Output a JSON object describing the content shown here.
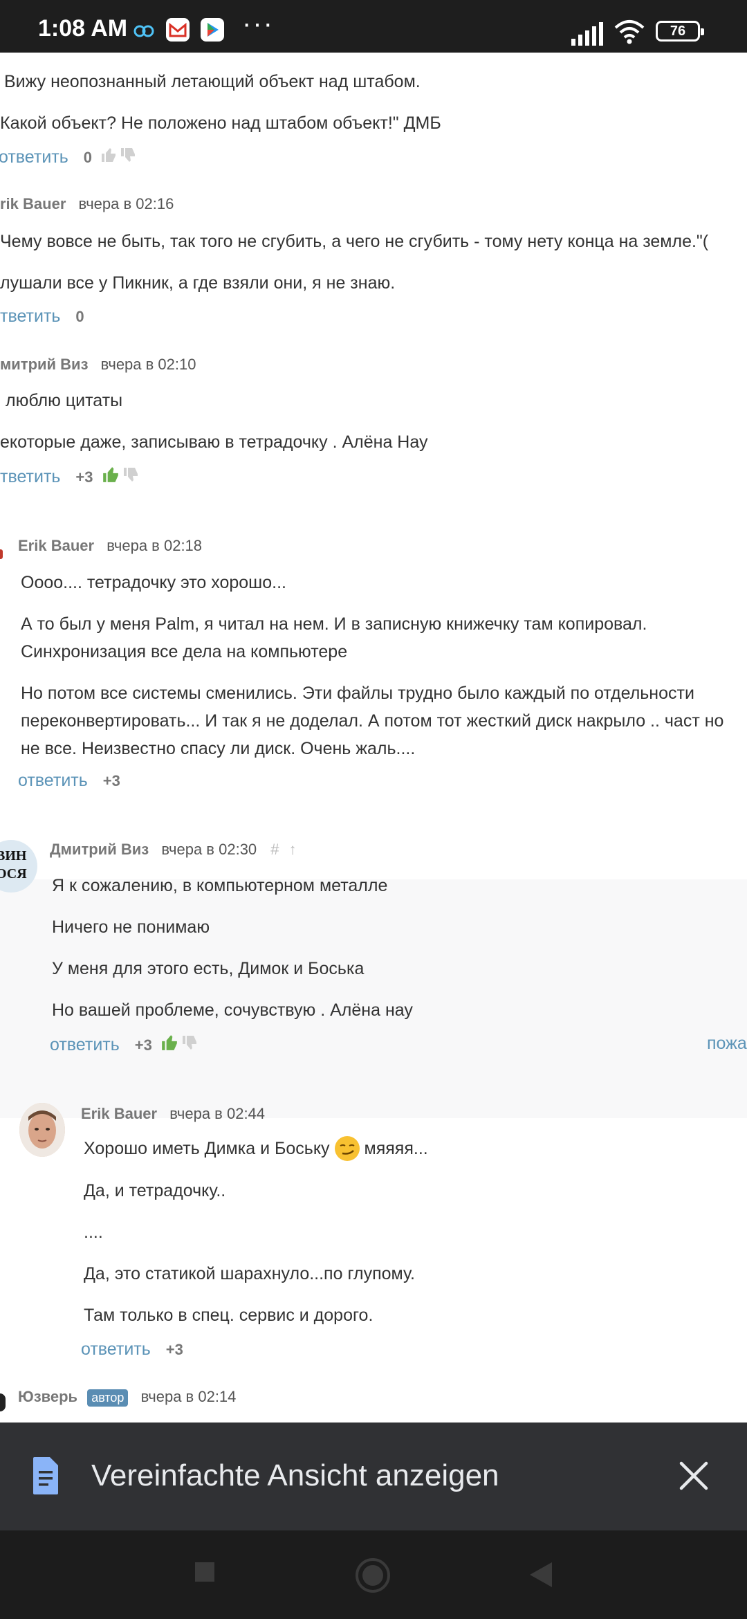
{
  "status_bar": {
    "time": "1:08 AM",
    "more_dots": "···",
    "battery": "76"
  },
  "comments": [
    {
      "paragraphs": [
        "Вижу неопознанный летающий объект над штабом.",
        "Какой объект? Не положено над штабом объект!\" ДМБ"
      ],
      "reply": "ответить",
      "score": "0"
    },
    {
      "author": "rik Bauer",
      "date": "вчера в 02:16",
      "paragraphs": [
        "Чему вовсе не быть, так того не сгубить, а чего не сгубить - тому нету конца на земле.\"(",
        "лушали все у Пикник, а где взяли они, я не знаю."
      ],
      "reply": "тветить",
      "score": "0"
    },
    {
      "author": "митрий Виз",
      "date": "вчера в 02:10",
      "paragraphs": [
        "люблю цитаты",
        "екоторые даже, записываю в тетрадочку . Алёна Нау"
      ],
      "reply": "тветить",
      "score": "+3"
    },
    {
      "author": "Erik Bauer",
      "date": "вчера в 02:18",
      "paragraphs": [
        "Оооо.... тетрадочку это хорошо...",
        "А то был у меня Palm, я читал на нем. И в записную книжечку там копировал. Синхронизация все дела на компьютере",
        "Но потом все системы сменились. Эти файлы трудно было каждый по отдельности переконвертировать... И так я не доделал. А потом тот жесткий диск накрыло .. част но не все. Неизвестно спасу ли диск. Очень жаль...."
      ],
      "reply": "ответить",
      "score": "+3"
    },
    {
      "author": "Дмитрий Виз",
      "date": "вчера в 02:30",
      "hash": "#",
      "up": "↑",
      "avatar_text_1": "ВИН",
      "avatar_text_2": "ОСЯ",
      "paragraphs": [
        "Я к сожалению, в компьютерном металле",
        "Ничего не понимаю",
        "У меня для этого есть, Димок и Боська",
        "Но вашей проблеме, сочувствую . Алёна нау"
      ],
      "reply": "ответить",
      "score": "+3",
      "complain": "пожа"
    },
    {
      "author": "Erik Bauer",
      "date": "вчера в 02:44",
      "paragraphs": [
        "Хорошо иметь Димка и Боську",
        "мяяяя...",
        "Да, и тетрадочку..",
        "....",
        "Да, это статикой шарахнуло...по глупому.",
        "Там только в спец. сервис и дорого."
      ],
      "reply": "ответить",
      "score": "+3"
    },
    {
      "author": "Юзверь",
      "badge": "автор",
      "date": "вчера в 02:14"
    }
  ],
  "simplified_view": {
    "label": "Vereinfachte Ansicht anzeigen"
  },
  "colors": {
    "link": "#5b93b7",
    "thumb_up_active": "#6ab04c",
    "panel_bg": "#303134"
  }
}
